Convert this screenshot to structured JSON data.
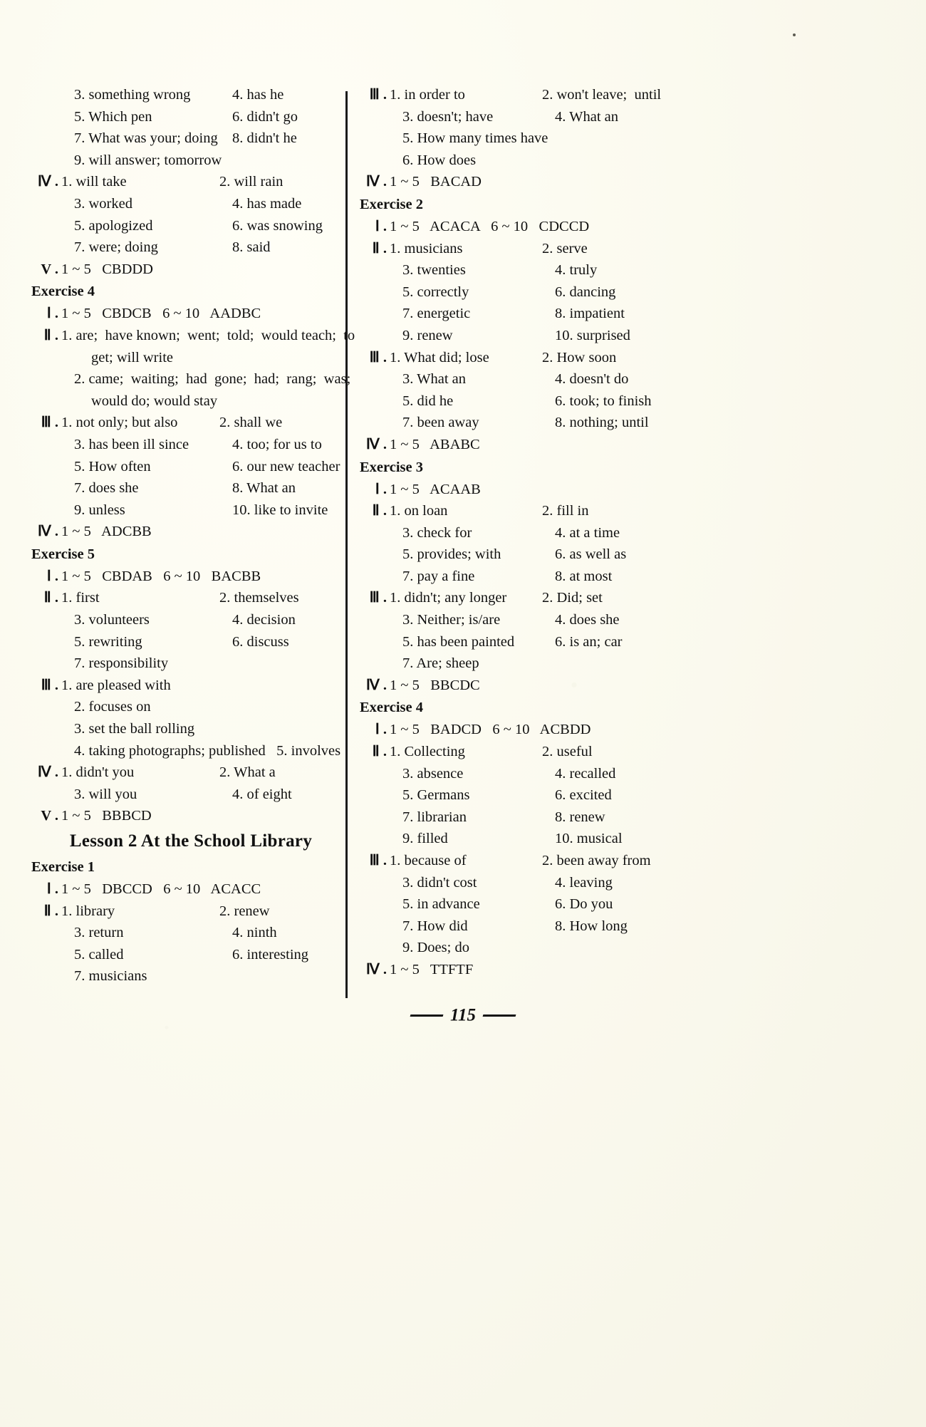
{
  "page": {
    "number": "115",
    "footer_left_rule": "—",
    "footer_right_rule": "—"
  },
  "left_column": {
    "lines": [
      {
        "kind": "pair_indent",
        "a": "3. something wrong",
        "b": "4. has he"
      },
      {
        "kind": "pair_indent",
        "a": "5. Which pen",
        "b": "6. didn't go"
      },
      {
        "kind": "pair_indent",
        "a": "7. What was your; doing",
        "b": "8. didn't he"
      },
      {
        "kind": "single_indent",
        "a": "9. will answer; tomorrow"
      },
      {
        "kind": "pair_roman",
        "rm": "Ⅳ",
        "a": "1. will take",
        "b": "2. will rain"
      },
      {
        "kind": "pair_indent",
        "a": "3. worked",
        "b": "4. has made"
      },
      {
        "kind": "pair_indent",
        "a": "5. apologized",
        "b": "6. was snowing"
      },
      {
        "kind": "pair_indent",
        "a": "7. were; doing",
        "b": "8. said"
      },
      {
        "kind": "single_roman",
        "rm": "V",
        "a": "1 ~ 5   CBDDD"
      },
      {
        "kind": "heading",
        "a": "Exercise 4"
      },
      {
        "kind": "single_roman",
        "rm": "Ⅰ",
        "a": "1 ~ 5   CBDCB   6 ~ 10   AADBC"
      },
      {
        "kind": "single_roman",
        "rm": "Ⅱ",
        "a": "1. are;  have known;  went;  told;  would teach;  to"
      },
      {
        "kind": "cont",
        "a": "get; will write"
      },
      {
        "kind": "single_indent_just",
        "a": "2. came;  waiting;  had  gone;  had;  rang;  was;"
      },
      {
        "kind": "cont",
        "a": "would do; would stay"
      },
      {
        "kind": "pair_roman",
        "rm": "Ⅲ",
        "a": "1. not only; but also",
        "b": "2. shall we"
      },
      {
        "kind": "pair_indent",
        "a": "3. has been ill since",
        "b": "4. too; for us to"
      },
      {
        "kind": "pair_indent",
        "a": "5. How often",
        "b": "6. our new teacher"
      },
      {
        "kind": "pair_indent",
        "a": "7. does she",
        "b": "8. What an"
      },
      {
        "kind": "pair_indent",
        "a": "9. unless",
        "b": "10. like to invite"
      },
      {
        "kind": "single_roman",
        "rm": "Ⅳ",
        "a": "1 ~ 5   ADCBB"
      },
      {
        "kind": "heading",
        "a": "Exercise 5"
      },
      {
        "kind": "single_roman",
        "rm": "Ⅰ",
        "a": "1 ~ 5   CBDAB   6 ~ 10   BACBB"
      },
      {
        "kind": "pair_roman",
        "rm": "Ⅱ",
        "a": "1. first",
        "b": "2. themselves"
      },
      {
        "kind": "pair_indent",
        "a": "3. volunteers",
        "b": "4. decision"
      },
      {
        "kind": "pair_indent",
        "a": "5. rewriting",
        "b": "6. discuss"
      },
      {
        "kind": "single_indent",
        "a": "7. responsibility"
      },
      {
        "kind": "single_roman",
        "rm": "Ⅲ",
        "a": "1. are pleased with"
      },
      {
        "kind": "single_indent",
        "a": "2. focuses on"
      },
      {
        "kind": "single_indent",
        "a": "3. set the ball rolling"
      },
      {
        "kind": "single_indent",
        "a": "4. taking photographs; published   5. involves"
      },
      {
        "kind": "pair_roman",
        "rm": "Ⅳ",
        "a": "1. didn't you",
        "b": "2. What a"
      },
      {
        "kind": "pair_indent",
        "a": "3. will you",
        "b": "4. of eight"
      },
      {
        "kind": "single_roman",
        "rm": "V",
        "a": "1 ~ 5   BBBCD"
      },
      {
        "kind": "lesson",
        "a": "Lesson 2    At the School Library"
      },
      {
        "kind": "heading",
        "a": "Exercise 1"
      },
      {
        "kind": "single_roman",
        "rm": "Ⅰ",
        "a": "1 ~ 5   DBCCD   6 ~ 10   ACACC"
      },
      {
        "kind": "pair_roman",
        "rm": "Ⅱ",
        "a": "1. library",
        "b": "2. renew"
      },
      {
        "kind": "pair_indent",
        "a": "3. return",
        "b": "4. ninth"
      },
      {
        "kind": "pair_indent",
        "a": "5. called",
        "b": "6. interesting"
      },
      {
        "kind": "single_indent",
        "a": "7. musicians"
      }
    ]
  },
  "right_column": {
    "lines": [
      {
        "kind": "pair_roman",
        "rm": "Ⅲ",
        "a": "1. in order to",
        "b": "2. won't leave;  until"
      },
      {
        "kind": "pair_indent",
        "a": "3. doesn't; have",
        "b": "4. What an"
      },
      {
        "kind": "single_indent",
        "a": "5. How many times have"
      },
      {
        "kind": "single_indent",
        "a": "6. How does"
      },
      {
        "kind": "single_roman",
        "rm": "Ⅳ",
        "a": "1 ~ 5   BACAD"
      },
      {
        "kind": "heading",
        "a": "Exercise 2"
      },
      {
        "kind": "single_roman",
        "rm": "Ⅰ",
        "a": "1 ~ 5   ACACA   6 ~ 10   CDCCD"
      },
      {
        "kind": "pair_roman",
        "rm": "Ⅱ",
        "a": "1. musicians",
        "b": "2. serve"
      },
      {
        "kind": "pair_indent",
        "a": "3. twenties",
        "b": "4. truly"
      },
      {
        "kind": "pair_indent",
        "a": "5. correctly",
        "b": "6. dancing"
      },
      {
        "kind": "pair_indent",
        "a": "7. energetic",
        "b": "8. impatient"
      },
      {
        "kind": "pair_indent",
        "a": "9. renew",
        "b": "10. surprised"
      },
      {
        "kind": "pair_roman",
        "rm": "Ⅲ",
        "a": "1. What did; lose",
        "b": "2. How soon"
      },
      {
        "kind": "pair_indent",
        "a": "3. What an",
        "b": "4. doesn't do"
      },
      {
        "kind": "pair_indent",
        "a": "5. did he",
        "b": "6. took; to finish"
      },
      {
        "kind": "pair_indent",
        "a": "7. been away",
        "b": "8. nothing; until"
      },
      {
        "kind": "single_roman",
        "rm": "Ⅳ",
        "a": "1 ~ 5   ABABC"
      },
      {
        "kind": "heading",
        "a": "Exercise 3"
      },
      {
        "kind": "single_roman",
        "rm": "Ⅰ",
        "a": "1 ~ 5   ACAAB"
      },
      {
        "kind": "pair_roman",
        "rm": "Ⅱ",
        "a": "1. on loan",
        "b": "2. fill in"
      },
      {
        "kind": "pair_indent",
        "a": "3. check for",
        "b": "4. at a time"
      },
      {
        "kind": "pair_indent",
        "a": "5. provides; with",
        "b": "6. as well as"
      },
      {
        "kind": "pair_indent",
        "a": "7. pay a fine",
        "b": "8. at most"
      },
      {
        "kind": "pair_roman",
        "rm": "Ⅲ",
        "a": "1. didn't; any longer",
        "b": "2. Did; set"
      },
      {
        "kind": "pair_indent",
        "a": "3. Neither; is/are",
        "b": "4. does she"
      },
      {
        "kind": "pair_indent",
        "a": "5. has been painted",
        "b": "6. is an; car"
      },
      {
        "kind": "single_indent",
        "a": "7. Are; sheep"
      },
      {
        "kind": "single_roman",
        "rm": "Ⅳ",
        "a": "1 ~ 5   BBCDC"
      },
      {
        "kind": "heading",
        "a": "Exercise 4"
      },
      {
        "kind": "single_roman",
        "rm": "Ⅰ",
        "a": "1 ~ 5   BADCD   6 ~ 10   ACBDD"
      },
      {
        "kind": "pair_roman",
        "rm": "Ⅱ",
        "a": "1. Collecting",
        "b": "2. useful"
      },
      {
        "kind": "pair_indent",
        "a": "3. absence",
        "b": "4. recalled"
      },
      {
        "kind": "pair_indent",
        "a": "5. Germans",
        "b": "6. excited"
      },
      {
        "kind": "pair_indent",
        "a": "7. librarian",
        "b": "8. renew"
      },
      {
        "kind": "pair_indent",
        "a": "9. filled",
        "b": "10. musical"
      },
      {
        "kind": "pair_roman",
        "rm": "Ⅲ",
        "a": "1. because of",
        "b": "2. been away from"
      },
      {
        "kind": "pair_indent",
        "a": "3. didn't cost",
        "b": "4. leaving"
      },
      {
        "kind": "pair_indent",
        "a": "5. in advance",
        "b": "6. Do you"
      },
      {
        "kind": "pair_indent",
        "a": "7. How did",
        "b": "8. How long"
      },
      {
        "kind": "single_indent",
        "a": "9. Does; do"
      },
      {
        "kind": "single_roman",
        "rm": "Ⅳ",
        "a": "1 ~ 5   TTFTF"
      }
    ]
  }
}
